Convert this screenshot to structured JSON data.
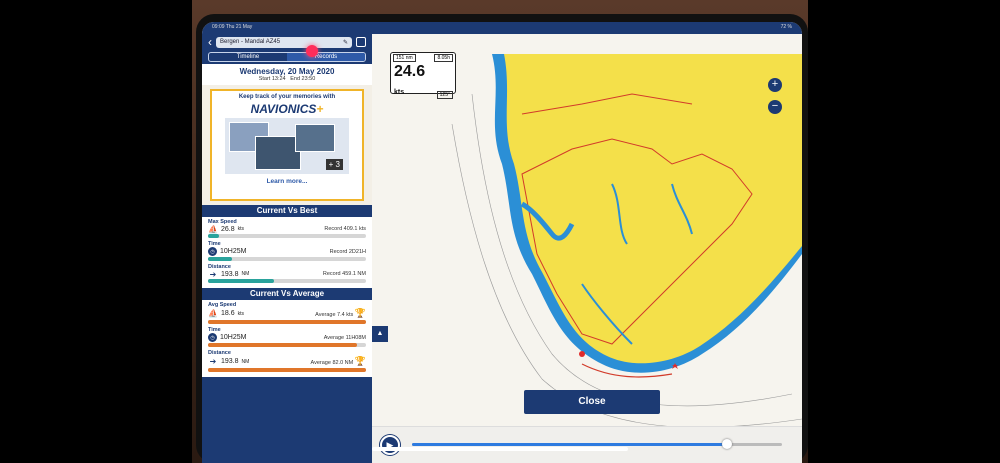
{
  "status": {
    "time": "09:09",
    "date": "Thu 21 May",
    "battery": "72 %"
  },
  "trip": {
    "title": "Bergen - Mandal AZ45",
    "back": "‹"
  },
  "tabs": [
    {
      "label": "Timeline",
      "active": false
    },
    {
      "label": "Records",
      "active": true
    }
  ],
  "date_box": {
    "date": "Wednesday, 20 May 2020",
    "start": "Start 13:24",
    "end": "End 23:50"
  },
  "promo": {
    "text": "Keep track of your memories with",
    "brand": "NAVIONICS",
    "plus": "+",
    "more": "+ 3",
    "link": "Learn more..."
  },
  "current_vs_best": {
    "title": "Current Vs Best",
    "items": [
      {
        "label": "Max Speed",
        "value": "26.8",
        "unit": "kts",
        "record_label": "Record",
        "record": "409.1 kts",
        "fraction": 0.07,
        "color": "#2aa39c"
      },
      {
        "label": "Time",
        "value": "10H25M",
        "unit": "",
        "record_label": "Record",
        "record": "2D21H",
        "fraction": 0.15,
        "color": "#2aa39c"
      },
      {
        "label": "Distance",
        "value": "193.8",
        "unit": "NM",
        "record_label": "Record",
        "record": "459.1 NM",
        "fraction": 0.42,
        "color": "#2aa39c"
      }
    ]
  },
  "current_vs_average": {
    "title": "Current Vs Average",
    "items": [
      {
        "label": "Avg Speed",
        "value": "18.6",
        "unit": "kts",
        "record_label": "Average",
        "record": "7.4 kts",
        "fraction": 1.0,
        "color": "#e0762a"
      },
      {
        "label": "Time",
        "value": "10H25M",
        "unit": "",
        "record_label": "Average",
        "record": "11H08M",
        "fraction": 0.94,
        "color": "#e0762a"
      },
      {
        "label": "Distance",
        "value": "193.8",
        "unit": "NM",
        "record_label": "Average",
        "record": "82.0 NM",
        "fraction": 1.0,
        "color": "#e0762a"
      }
    ]
  },
  "speed_box": {
    "sog": "151",
    "sog_unit": "nm",
    "time": "8.05",
    "time_unit": "h",
    "heading": "125°",
    "speed": "24.6",
    "speed_unit": "kts"
  },
  "zoom": {
    "in": "+",
    "out": "−"
  },
  "close": "Close",
  "playback": {
    "progress": 0.85
  },
  "colors": {
    "navy": "#1c3a73",
    "land": "#f4e04a",
    "water": "#2b8fd6"
  }
}
